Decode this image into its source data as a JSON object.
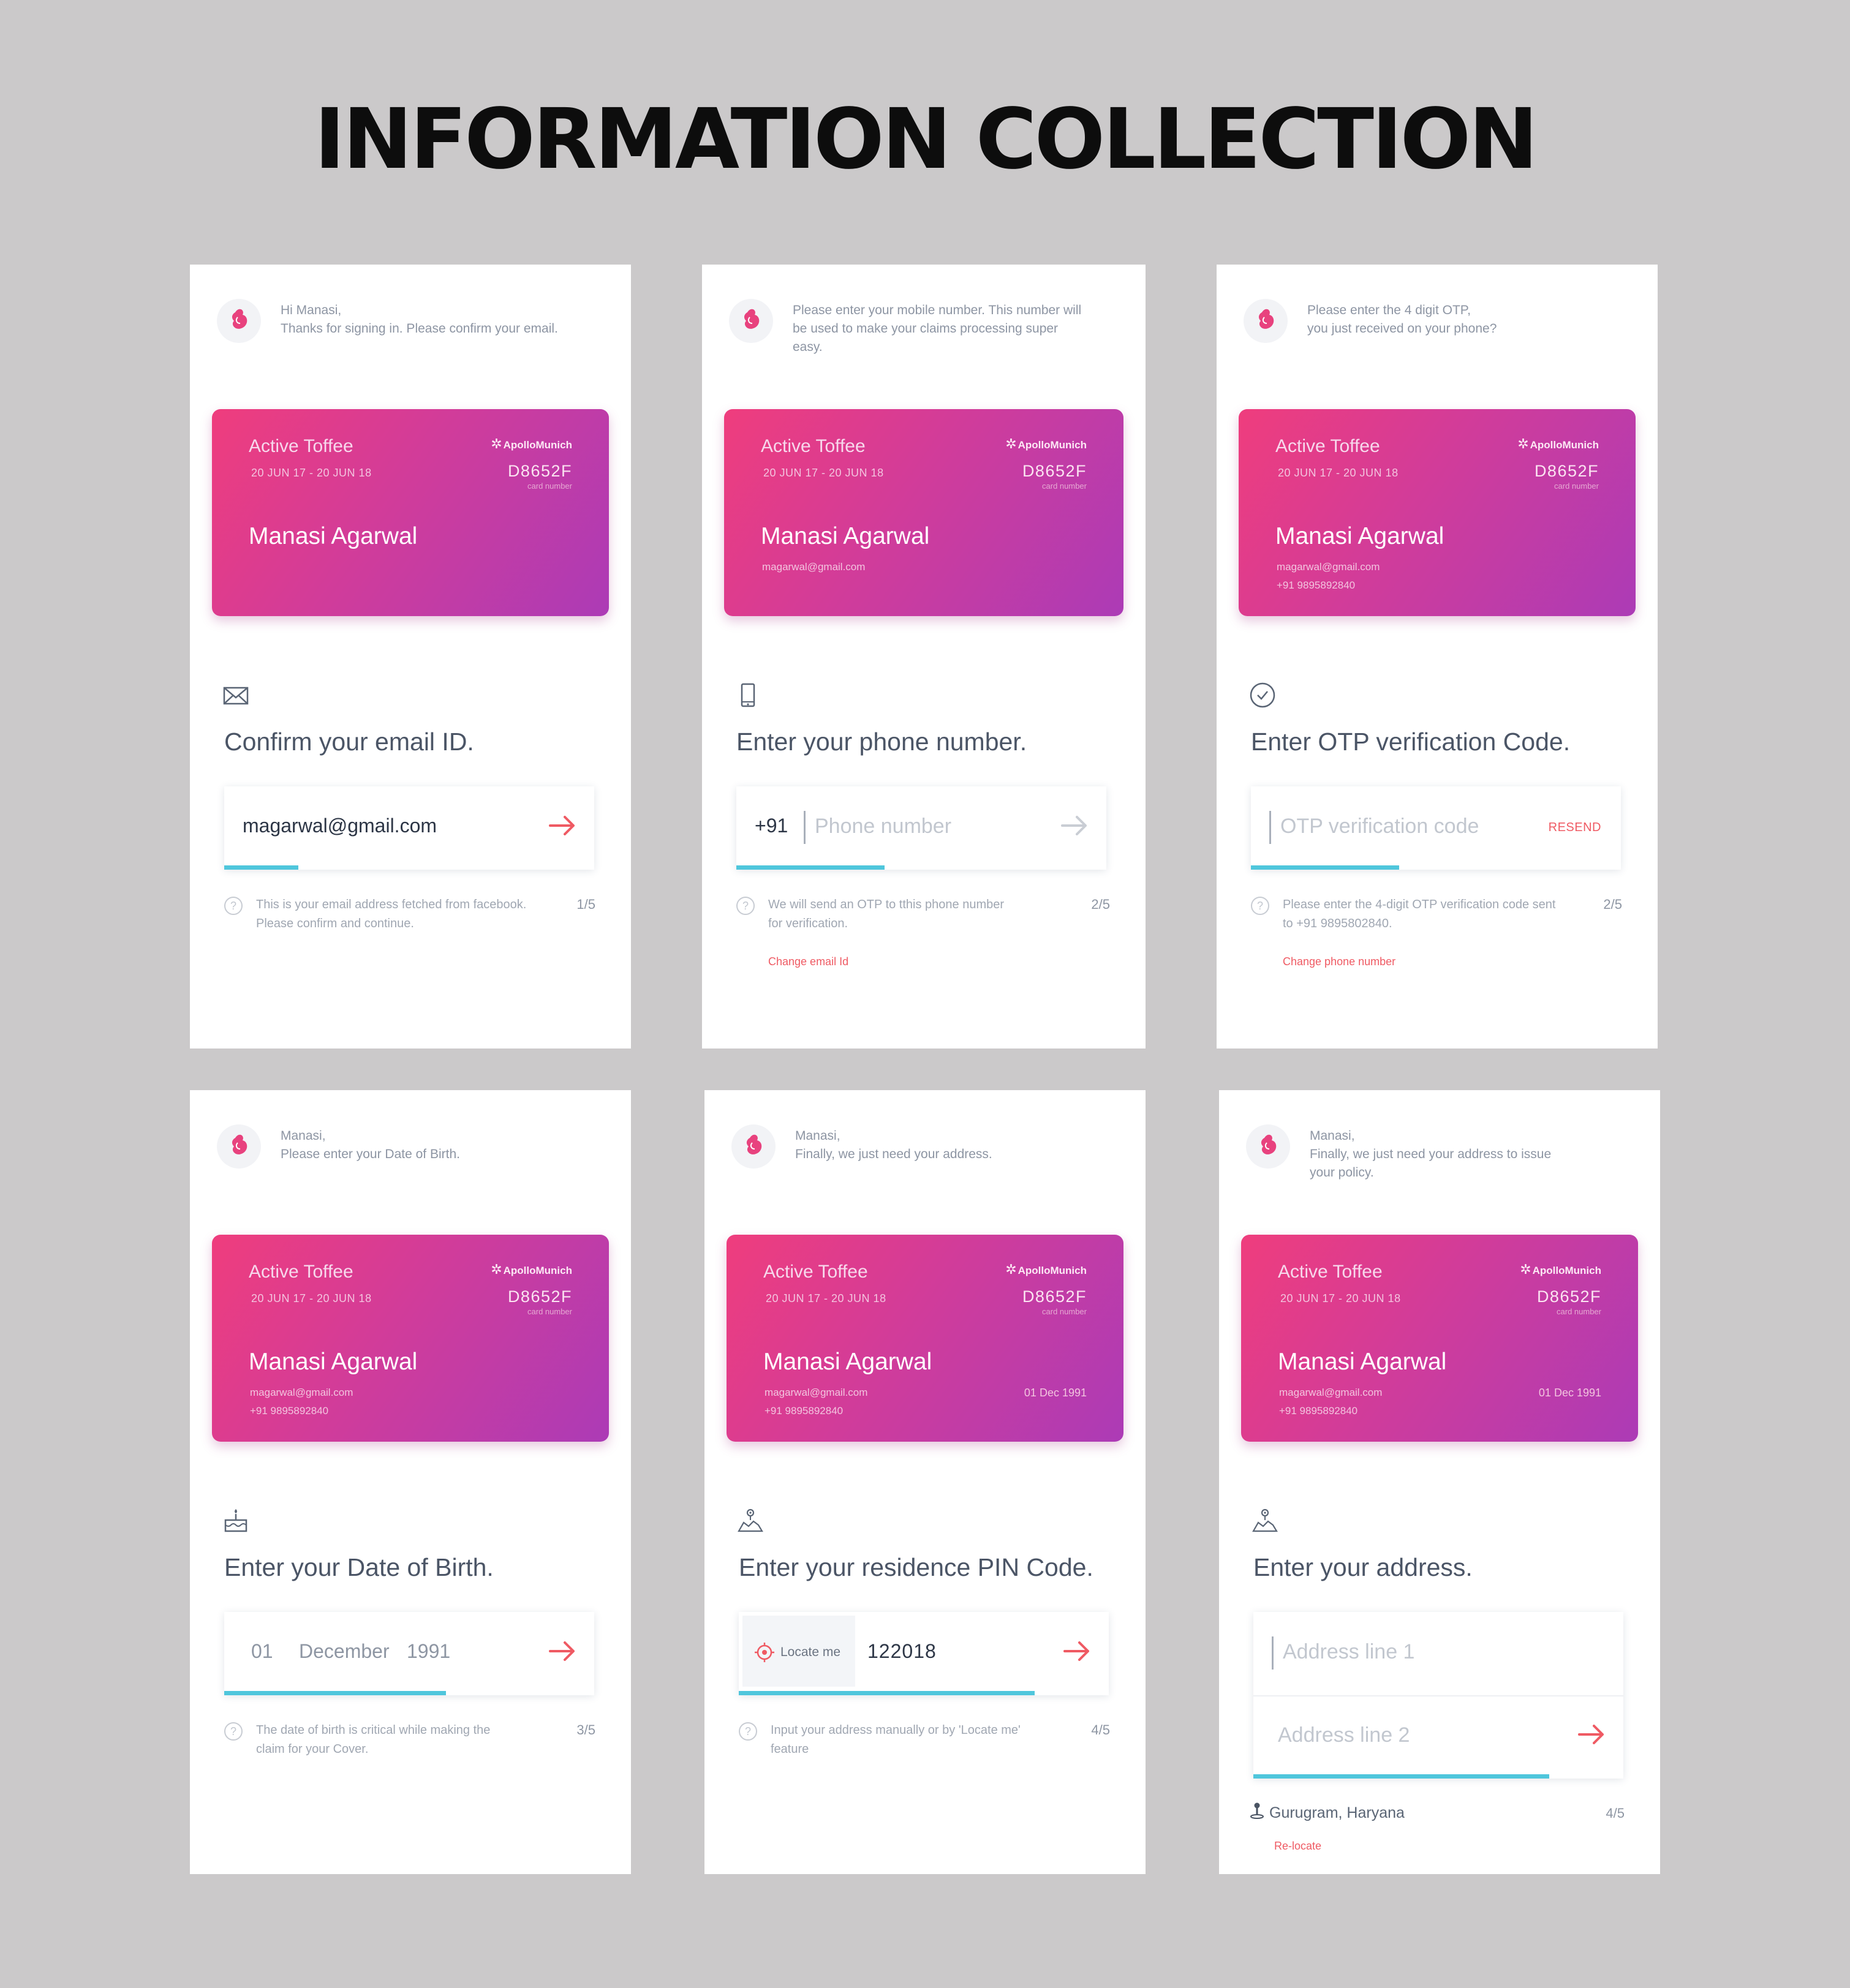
{
  "title": "INFORMATION COLLECTION",
  "colors": {
    "background": "#cbc9ca",
    "card_gradient_start": "#ef3d7d",
    "card_gradient_end": "#ac3bb6",
    "accent_red": "#ef5a63",
    "progress_cyan": "#4fc6dc"
  },
  "card": {
    "plan": "Active Toffee",
    "dates": "20 JUN 17 - 20 JUN 18",
    "insurer": "ApolloMunich",
    "card_number": "D8652F",
    "card_number_label": "card number",
    "name": "Manasi Agarwal",
    "email": "magarwal@gmail.com",
    "phone": "+91 9895892840",
    "dob": "01 Dec 1991"
  },
  "screens": [
    {
      "greeting_line1": "Hi Manasi,",
      "greeting_line2": "Thanks for signing in. Please confirm your email.",
      "icon": "envelope-icon",
      "heading": "Confirm  your  email ID.",
      "value": "magarwal@gmail.com",
      "progress": 0.2,
      "help": "This is your email address fetched from facebook. Please confirm and continue.",
      "step": "1/5"
    },
    {
      "greeting": "Please enter your mobile number. This number will be used  to make your claims processing super easy.",
      "icon": "mobile-phone-icon",
      "heading": "Enter your phone number.",
      "prefix": "+91",
      "placeholder": "Phone number",
      "progress": 0.4,
      "help": "We will send an OTP to tthis phone number for verification.",
      "step": "2/5",
      "link": "Change  email Id"
    },
    {
      "greeting_line1": "Please enter the 4 digit OTP,",
      "greeting_line2": "you just received on your phone?",
      "icon": "check-circle-icon",
      "heading": "Enter OTP verification Code.",
      "placeholder": "OTP verification code",
      "resend": "RESEND",
      "progress": 0.4,
      "help": "Please enter the 4-digit OTP verification code sent to  +91 9895802840.",
      "step": "2/5",
      "link": "Change phone number"
    },
    {
      "greeting_line1": "Manasi,",
      "greeting_line2": "Please enter your Date of Birth.",
      "icon": "cake-icon",
      "heading": "Enter your Date of Birth.",
      "day": "01",
      "month": "December",
      "year": "1991",
      "progress": 0.6,
      "help": "The date of birth is critical while making the claim for your Cover.",
      "step": "3/5"
    },
    {
      "greeting_line1": "Manasi,",
      "greeting_line2": "Finally, we just need your address.",
      "icon": "map-pin-icon",
      "heading": "Enter your residence PIN Code.",
      "locate": "Locate me",
      "value": "122018",
      "progress": 0.8,
      "help": "Input your address manually or by 'Locate me' feature",
      "step": "4/5"
    },
    {
      "greeting_line1": "Manasi,",
      "greeting_line2": "Finally, we just need your address to issue your policy.",
      "icon": "map-pin-icon",
      "heading": "Enter your address.",
      "placeholder1": "Address line 1",
      "placeholder2": "Address line 2",
      "progress": 0.8,
      "location": "Gurugram, Haryana",
      "step": "4/5",
      "link": "Re-locate"
    }
  ]
}
